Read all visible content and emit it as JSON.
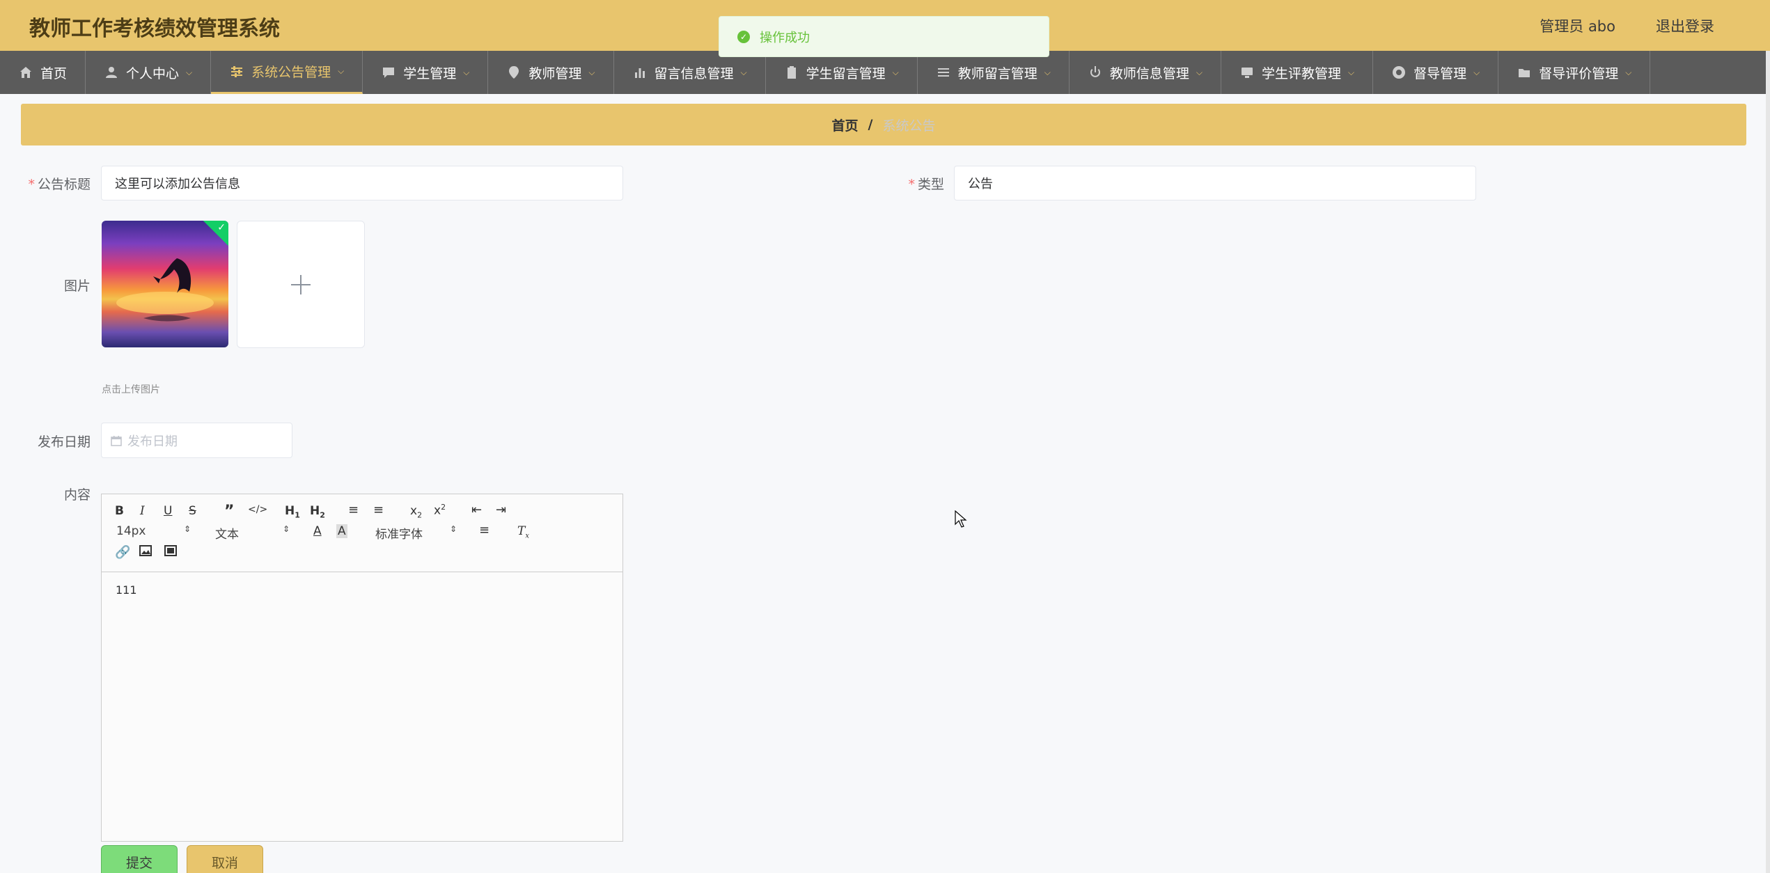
{
  "header": {
    "title": "教师工作考核绩效管理系统",
    "user_label": "管理员 abo",
    "logout_label": "退出登录"
  },
  "nav": {
    "items": [
      {
        "label": "首页",
        "icon": "home-icon"
      },
      {
        "label": "个人中心",
        "icon": "user-icon"
      },
      {
        "label": "系统公告管理",
        "icon": "sliders-icon"
      },
      {
        "label": "学生管理",
        "icon": "chat-icon"
      },
      {
        "label": "教师管理",
        "icon": "location-icon"
      },
      {
        "label": "留言信息管理",
        "icon": "bar-chart-icon"
      },
      {
        "label": "学生留言管理",
        "icon": "clipboard-icon"
      },
      {
        "label": "教师留言管理",
        "icon": "list-icon"
      },
      {
        "label": "教师信息管理",
        "icon": "power-icon"
      },
      {
        "label": "学生评教管理",
        "icon": "monitor-icon"
      },
      {
        "label": "督导管理",
        "icon": "lifebuoy-icon"
      },
      {
        "label": "督导评价管理",
        "icon": "folder-icon"
      }
    ],
    "active_index": 2
  },
  "breadcrumb": {
    "home": "首页",
    "separator": "/",
    "current": "系统公告"
  },
  "form": {
    "title_label": "公告标题",
    "title_value": "这里可以添加公告信息",
    "type_label": "类型",
    "type_value": "公告",
    "image_label": "图片",
    "upload_tip": "点击上传图片",
    "date_label": "发布日期",
    "date_placeholder": "发布日期",
    "content_label": "内容",
    "content_value": "111"
  },
  "editor": {
    "font_size": "14px",
    "header_select": "文本",
    "font_family": "标准字体"
  },
  "buttons": {
    "submit": "提交",
    "cancel": "取消"
  },
  "toast": {
    "message": "操作成功"
  },
  "colors": {
    "header_bg": "#e8c56d",
    "nav_bg": "#5b5b5b",
    "accent": "#e8c56d",
    "submit_bg": "#7ddc7a",
    "toast_text": "#67c23a"
  }
}
